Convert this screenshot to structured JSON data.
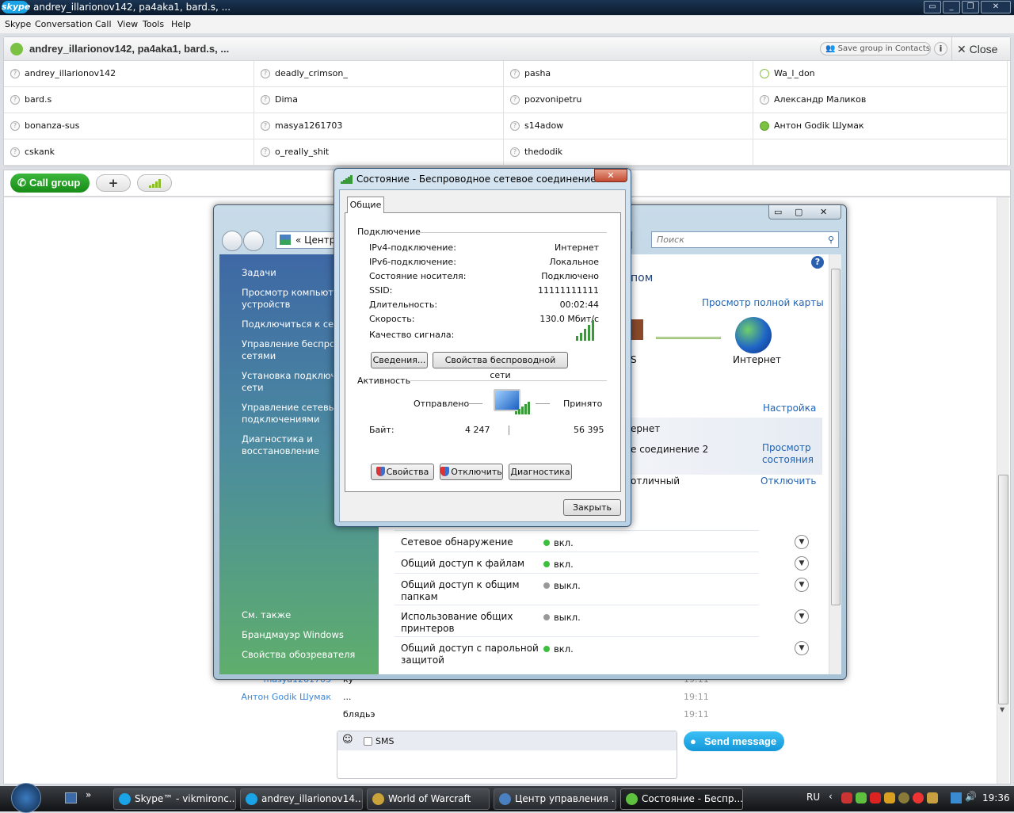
{
  "window": {
    "logo": "skype",
    "title": "andrey_illarionov142, pa4aka1, bard.s, ..."
  },
  "menu": [
    "Skype",
    "Conversation",
    "Call",
    "View",
    "Tools",
    "Help"
  ],
  "conversation": {
    "title": "andrey_illarionov142, pa4aka1, bard.s, ...",
    "save_group": "Save group in Contacts",
    "info": "i",
    "close": "Close",
    "participants": [
      {
        "name": "andrey_illarionov142",
        "status": "unknown"
      },
      {
        "name": "deadly_crimson_",
        "status": "unknown"
      },
      {
        "name": "pasha",
        "status": "unknown"
      },
      {
        "name": "Wa_l_don",
        "status": "away"
      },
      {
        "name": "bard.s",
        "status": "unknown"
      },
      {
        "name": "Dima",
        "status": "unknown"
      },
      {
        "name": "pozvonipetru",
        "status": "unknown"
      },
      {
        "name": "Александр Маликов",
        "status": "unknown"
      },
      {
        "name": "bonanza-sus",
        "status": "unknown"
      },
      {
        "name": "masya1261703",
        "status": "unknown"
      },
      {
        "name": "s14adow",
        "status": "unknown"
      },
      {
        "name": "Антон Godik Шумак",
        "status": "online"
      },
      {
        "name": "cskank",
        "status": "unknown"
      },
      {
        "name": "o_really_shit",
        "status": "unknown"
      },
      {
        "name": "thedodik",
        "status": "unknown"
      }
    ]
  },
  "toolbar": {
    "call_group": "Call group",
    "add": "+"
  },
  "messages": [
    {
      "name": "masya1261703",
      "text": "ку",
      "time": "19:11"
    },
    {
      "name": "Антон Godik Шумак",
      "text": "...",
      "time": "19:11"
    },
    {
      "name": "",
      "text": "блядьэ",
      "time": "19:11"
    }
  ],
  "composer": {
    "sms_label": "SMS",
    "sms_checked": false,
    "send": "Send message"
  },
  "network_center": {
    "address": "Центр",
    "search_placeholder": "Поиск",
    "sidebar": {
      "tasks_header": "Задачи",
      "tasks": [
        "Просмотр компьюте\nустройств",
        "Подключиться к сети",
        "Управление беспров\nсетями",
        "Установка подключе\nсети",
        "Управление сетевым\nподключениями",
        "Диагностика и\nвосстановление"
      ],
      "see_also_header": "См. также",
      "see_also": [
        "Брандмауэр Windows",
        "Свойства обозревателя"
      ]
    },
    "title_fragment": "пом",
    "view_full_map": "Просмотр полной карты",
    "map_left_fragment": "S",
    "internet_label": "Интернет",
    "configure": "Настройка",
    "row_fragments": [
      "ернет",
      "е соединение 2",
      "отличный"
    ],
    "view_status": "Просмотр\nсостояния",
    "disconnect": "Отключить",
    "sharing": [
      {
        "label": "Сетевое обнаружение",
        "value": "вкл.",
        "on": true
      },
      {
        "label": "Общий доступ к файлам",
        "value": "вкл.",
        "on": true
      },
      {
        "label": "Общий доступ к общим\nпапкам",
        "value": "выкл.",
        "on": false
      },
      {
        "label": "Использование общих\nпринтеров",
        "value": "выкл.",
        "on": false
      },
      {
        "label": "Общий доступ с парольной\nзащитой",
        "value": "вкл.",
        "on": true
      }
    ]
  },
  "status_dialog": {
    "title": "Состояние - Беспроводное сетевое соединение 2",
    "tab": "Общие",
    "connection_header": "Подключение",
    "fields": [
      {
        "label": "IPv4-подключение:",
        "value": "Интернет"
      },
      {
        "label": "IPv6-подключение:",
        "value": "Локальное"
      },
      {
        "label": "Состояние носителя:",
        "value": "Подключено"
      },
      {
        "label": "SSID:",
        "value": "11111111111"
      },
      {
        "label": "Длительность:",
        "value": "00:02:44"
      },
      {
        "label": "Скорость:",
        "value": "130.0 Мбит/с"
      }
    ],
    "signal_label": "Качество сигнала:",
    "signal_bars": 5,
    "details_btn": "Сведения...",
    "wireless_props_btn": "Свойства беспроводной сети",
    "activity_header": "Активность",
    "sent_label": "Отправлено",
    "received_label": "Принято",
    "bytes_label": "Байт:",
    "bytes_sent": "4 247",
    "bytes_received": "56 395",
    "properties_btn": "Свойства",
    "disable_btn": "Отключить",
    "diagnose_btn": "Диагностика",
    "close_btn": "Закрыть"
  },
  "taskbar": {
    "items": [
      {
        "label": "Skype™ - vikmironc...",
        "icon": "skype-icon",
        "color": "#1aa3e6"
      },
      {
        "label": "andrey_illarionov14...",
        "icon": "chat-icon",
        "color": "#1aa3e6"
      },
      {
        "label": "World of Warcraft",
        "icon": "wow-icon",
        "color": "#c9a23a"
      },
      {
        "label": "Центр управления ...",
        "icon": "network-icon",
        "color": "#4a7fc0"
      },
      {
        "label": "Состояние - Беспр...",
        "icon": "signal-icon",
        "color": "#5fbf3f"
      }
    ],
    "lang": "RU",
    "clock": "19:36"
  }
}
